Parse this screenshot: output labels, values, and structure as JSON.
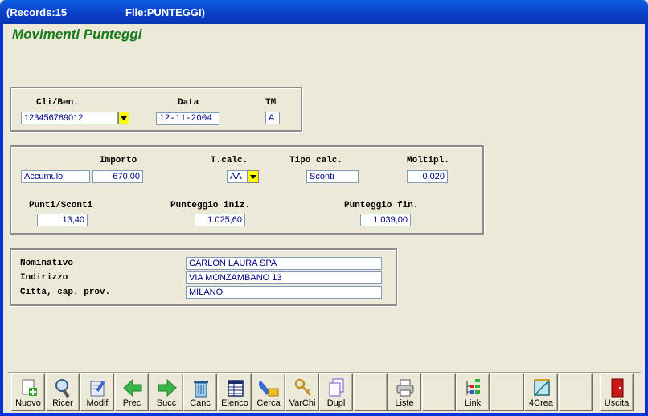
{
  "window": {
    "records": "(Records:15",
    "file": "File:PUNTEGGI)"
  },
  "form_title": "Movimenti Punteggi",
  "group1": {
    "cli_label": "Cli/Ben.",
    "cli_value": "123456789012",
    "data_label": "Data",
    "data_value": "12-11-2004",
    "tm_label": "TM",
    "tm_value": "A"
  },
  "group2": {
    "type_value": "Accumulo",
    "importo_label": "Importo",
    "importo_value": "670,00",
    "tcalc_label": "T.calc.",
    "tcalc_value": "AA",
    "tipocalc_label": "Tipo calc.",
    "tipocalc_value": "Sconti",
    "moltipl_label": "Moltipl.",
    "moltipl_value": "0,020",
    "punti_label": "Punti/Sconti",
    "punti_value": "13,40",
    "pini_label": "Punteggio iniz.",
    "pini_value": "1.025,60",
    "pfin_label": "Punteggio fin.",
    "pfin_value": "1.039,00"
  },
  "group3": {
    "nominativo_label": "Nominativo",
    "nominativo_value": "CARLON LAURA SPA",
    "indirizzo_label": "Indirizzo",
    "indirizzo_value": "VIA MONZAMBANO 13",
    "citta_label": "Città, cap. prov.",
    "citta_value": "MILANO"
  },
  "toolbar": [
    {
      "label": "Nuovo",
      "icon": "new-icon"
    },
    {
      "label": "Ricer",
      "icon": "search-icon"
    },
    {
      "label": "Modif",
      "icon": "edit-icon"
    },
    {
      "label": "Prec",
      "icon": "arrow-left-icon"
    },
    {
      "label": "Succ",
      "icon": "arrow-right-icon"
    },
    {
      "label": "Canc",
      "icon": "trash-icon"
    },
    {
      "label": "Elenco",
      "icon": "list-icon"
    },
    {
      "label": "Cerca",
      "icon": "find-icon"
    },
    {
      "label": "VarChi",
      "icon": "keys-icon"
    },
    {
      "label": "Dupl",
      "icon": "duplicate-icon"
    },
    {
      "label": "",
      "icon": ""
    },
    {
      "label": "Liste",
      "icon": "printer-icon"
    },
    {
      "label": "",
      "icon": ""
    },
    {
      "label": "Link",
      "icon": "link-icon"
    },
    {
      "label": "",
      "icon": ""
    },
    {
      "label": "4Crea",
      "icon": "create-icon"
    },
    {
      "label": "",
      "icon": ""
    },
    {
      "label": "Uscita",
      "icon": "exit-door-icon"
    }
  ]
}
